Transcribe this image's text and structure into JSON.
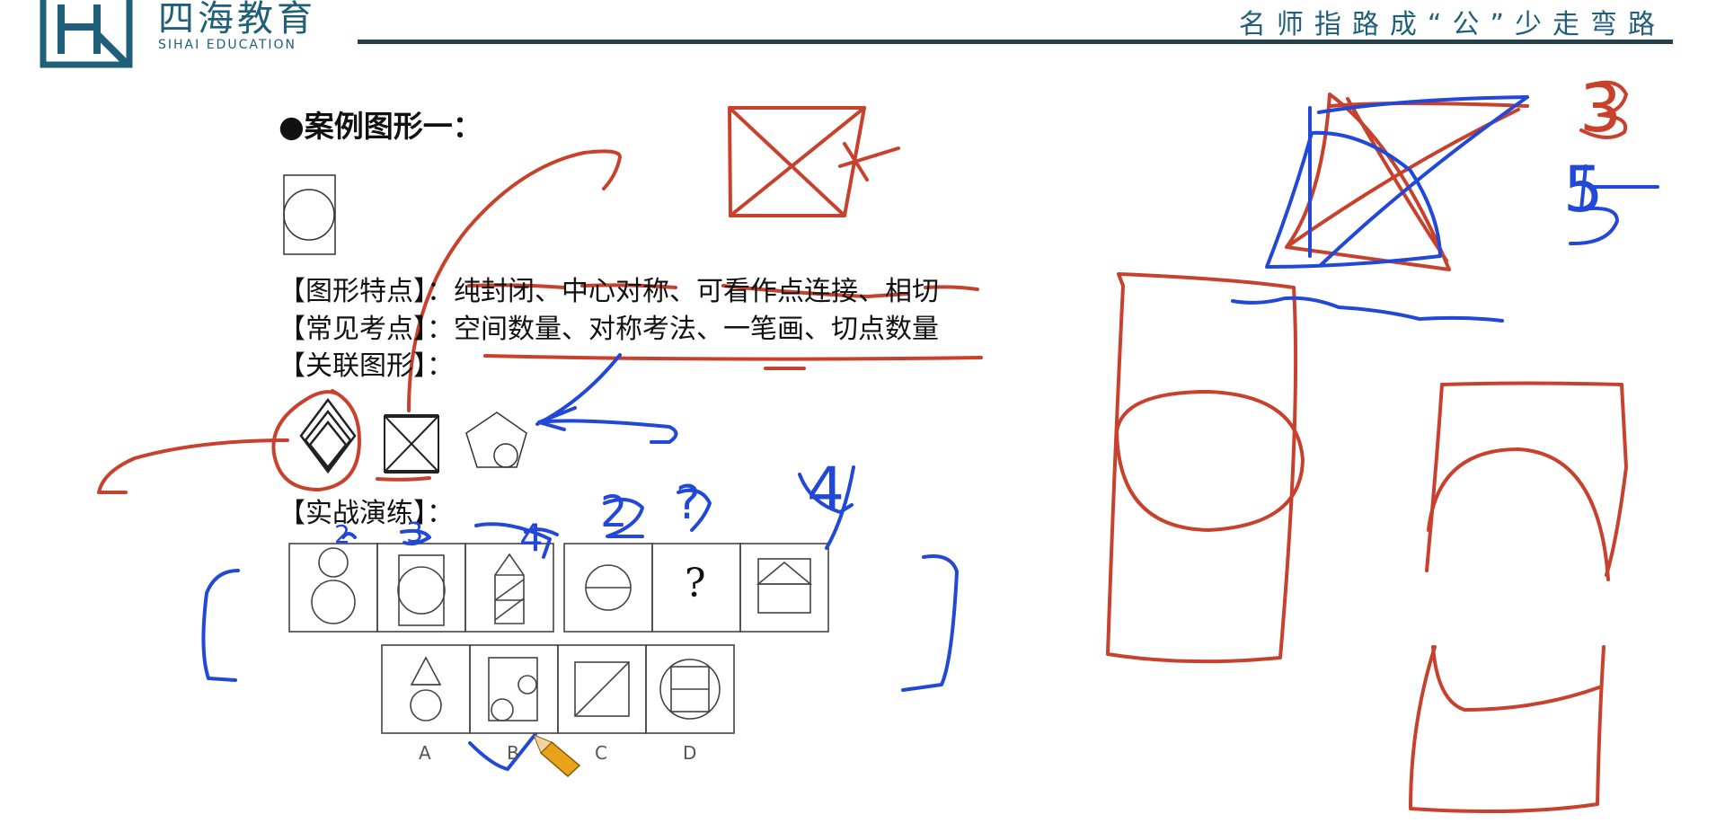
{
  "header": {
    "logo_text": "四海教育",
    "logo_sub": "SIHAI EDUCATION",
    "slogan": "名师指路成“公”少走弯路"
  },
  "content": {
    "heading": "●案例图形一：",
    "features_line": "【图形特点】：纯封闭、中心对称、可看作点连接、相切",
    "exam_points_line": "【常见考点】：空间数量、对称考法、一笔画、切点数量",
    "related_line": "【关联图形】：",
    "practice_line": "【实战演练】：",
    "question_mark": "?",
    "options": [
      "A",
      "B",
      "C",
      "D"
    ]
  },
  "annotations": {
    "numbers": [
      "3",
      "5",
      "2",
      "3",
      "4",
      "2",
      "?",
      "4"
    ]
  },
  "colors": {
    "brand": "#1f5f7a",
    "ink_red": "#c8412d",
    "ink_blue": "#2248d8",
    "text": "#111111"
  }
}
